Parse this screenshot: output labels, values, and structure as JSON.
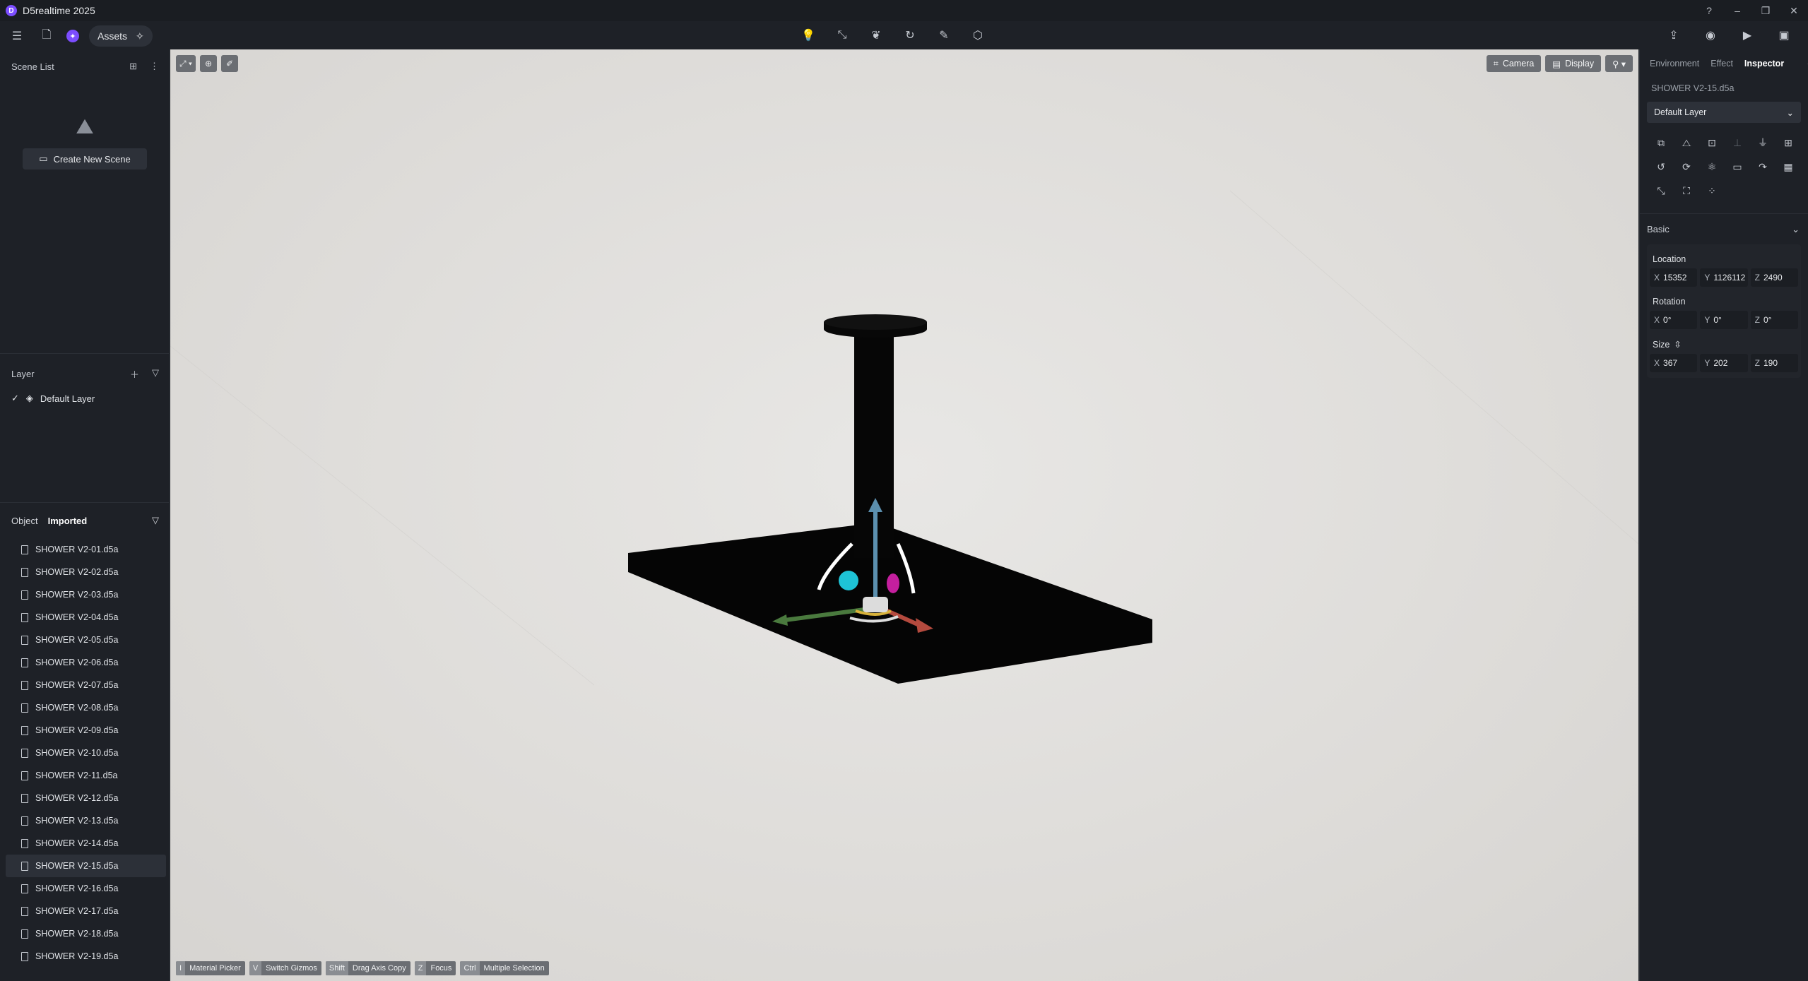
{
  "app": {
    "title": "D5realtime 2025",
    "logo": "D"
  },
  "toolbar": {
    "assets_label": "Assets",
    "center_icons": [
      "lightbulb-icon",
      "path-icon",
      "leaf-icon",
      "rotate-icon",
      "pen-icon",
      "terrain-icon"
    ],
    "right_icons": [
      "share-icon",
      "camera-icon",
      "video-icon",
      "render-icon"
    ]
  },
  "scene_list": {
    "header": "Scene List",
    "create_button": "Create New Scene"
  },
  "layer_panel": {
    "header": "Layer",
    "layers": [
      {
        "name": "Default Layer",
        "checked": true
      }
    ]
  },
  "object_panel": {
    "tab_object": "Object",
    "tab_imported": "Imported",
    "files": [
      "SHOWER V2-01.d5a",
      "SHOWER V2-02.d5a",
      "SHOWER V2-03.d5a",
      "SHOWER V2-04.d5a",
      "SHOWER V2-05.d5a",
      "SHOWER V2-06.d5a",
      "SHOWER V2-07.d5a",
      "SHOWER V2-08.d5a",
      "SHOWER V2-09.d5a",
      "SHOWER V2-10.d5a",
      "SHOWER V2-11.d5a",
      "SHOWER V2-12.d5a",
      "SHOWER V2-13.d5a",
      "SHOWER V2-14.d5a",
      "SHOWER V2-15.d5a",
      "SHOWER V2-16.d5a",
      "SHOWER V2-17.d5a",
      "SHOWER V2-18.d5a",
      "SHOWER V2-19.d5a"
    ],
    "selected": "SHOWER V2-15.d5a"
  },
  "viewport": {
    "camera_label": "Camera",
    "display_label": "Display",
    "hints": [
      {
        "key": "I",
        "label": "Material Picker"
      },
      {
        "key": "V",
        "label": "Switch Gizmos"
      },
      {
        "key": "Shift",
        "label": "Drag Axis Copy"
      },
      {
        "key": "Z",
        "label": "Focus"
      },
      {
        "key": "Ctrl",
        "label": "Multiple Selection"
      }
    ]
  },
  "inspector": {
    "tabs": {
      "environment": "Environment",
      "effect": "Effect",
      "inspector": "Inspector"
    },
    "object_name": "SHOWER V2-15.d5a",
    "layer": "Default Layer",
    "section": "Basic",
    "location": {
      "label": "Location",
      "x": "15352",
      "y": "1126112",
      "z": "2490"
    },
    "rotation": {
      "label": "Rotation",
      "x": "0°",
      "y": "0°",
      "z": "0°"
    },
    "size": {
      "label": "Size",
      "x": "367",
      "y": "202",
      "z": "190"
    }
  },
  "colors": {
    "accent": "#7c4dff",
    "panel": "#1e2127",
    "viewport": "#e2e0dd"
  }
}
